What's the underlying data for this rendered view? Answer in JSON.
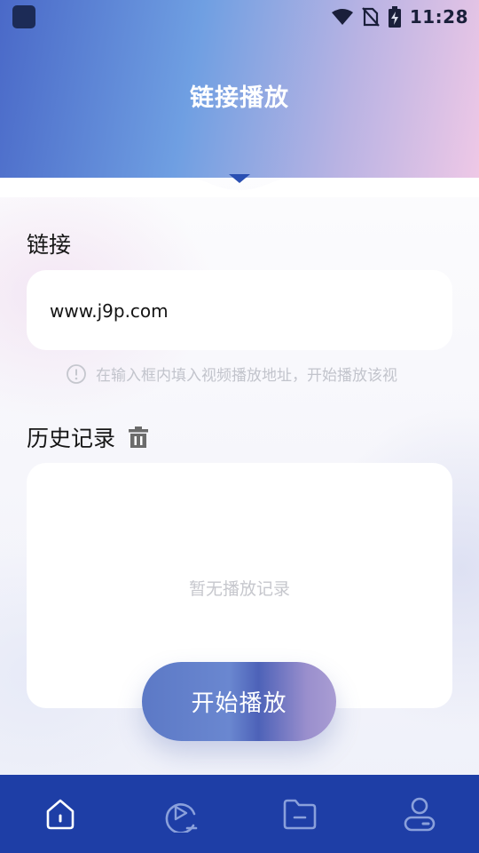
{
  "status_bar": {
    "time": "11:28",
    "icons": [
      "wifi-icon",
      "no-sim-icon",
      "battery-charging-icon"
    ]
  },
  "header": {
    "title": "链接播放"
  },
  "link_section": {
    "label": "链接",
    "input_value": "www.j9p.com",
    "hint": "在输入框内填入视频播放地址，开始播放该视"
  },
  "history_section": {
    "label": "历史记录",
    "delete_icon": "trash-icon",
    "empty_text": "暂无播放记录"
  },
  "play_button": {
    "label": "开始播放"
  },
  "bottom_nav": {
    "items": [
      {
        "icon": "home-icon",
        "active": true
      },
      {
        "icon": "video-play-icon",
        "active": false
      },
      {
        "icon": "folder-icon",
        "active": false
      },
      {
        "icon": "user-icon",
        "active": false
      }
    ]
  },
  "colors": {
    "nav_background": "#1e3ea6",
    "header_gradient_start": "#4a69c8",
    "header_gradient_end": "#eec8e6",
    "button_gradient_start": "#5c79c6",
    "button_gradient_end": "#a99dd3"
  }
}
